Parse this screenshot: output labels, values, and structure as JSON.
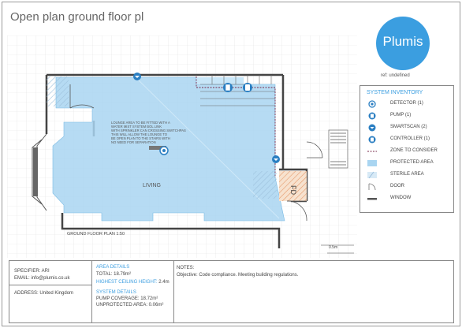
{
  "header": {
    "title": "Open plan ground floor pl"
  },
  "brand": {
    "logo_text": "Plumis",
    "ref_text": "ref: undefined",
    "accent": "#3b9ee0"
  },
  "plan": {
    "annotation_lines": [
      "LOUNGE AREA TO BE FITTED WITH A",
      "WATER MIST SYSTEM BOL LINK",
      "WITH SPRINKLER CAN CROSSING SWITCHPAS",
      "THIS WILL ALLOW THE LOUNGE TO",
      "BE OPEN PLAN TO THE STAIRS WITH",
      "NO NEED FOR SEPARATION"
    ],
    "room_label": "LIVING",
    "fd_label": "FD",
    "plan_caption": "GROUND FLOOR PLAN 1:50",
    "scale_label": "0.5m"
  },
  "inventory": {
    "heading": "SYSTEM INVENTORY",
    "items": [
      {
        "label": "DETECTOR (1)",
        "icon": "detector-icon"
      },
      {
        "label": "PUMP (1)",
        "icon": "pump-icon"
      },
      {
        "label": "SMARTSCAN (2)",
        "icon": "smartscan-icon"
      },
      {
        "label": "CONTROLLER (1)",
        "icon": "controller-icon"
      },
      {
        "label": "ZONE TO CONSIDER",
        "icon": "zone-line-icon"
      },
      {
        "label": "PROTECTED AREA",
        "icon": "protected-swatch-icon"
      },
      {
        "label": "STERILE AREA",
        "icon": "sterile-swatch-icon"
      },
      {
        "label": "DOOR",
        "icon": "door-icon"
      },
      {
        "label": "WINDOW",
        "icon": "window-icon"
      }
    ]
  },
  "footer": {
    "specifier": "SPECIFIER: ARI",
    "email": "EMAIL: info@plumis.co.uk",
    "address": "ADDRESS: United Kingdom",
    "area_heading": "AREA DETAILS",
    "area_total": "TOTAL: 18.79m²",
    "ceiling_heading": "HIGHEST CEILING HEIGHT: ",
    "ceiling_value": "2.4m",
    "system_heading": "SYSTEM DETAILS",
    "pump_coverage": "PUMP COVERAGE: 18.72m²",
    "unprotected": "UNPROTECTED AREA: 0.06m²",
    "notes_heading": "NOTES:",
    "notes_text": "Objective: Code compliance. Meeting building regulations."
  }
}
